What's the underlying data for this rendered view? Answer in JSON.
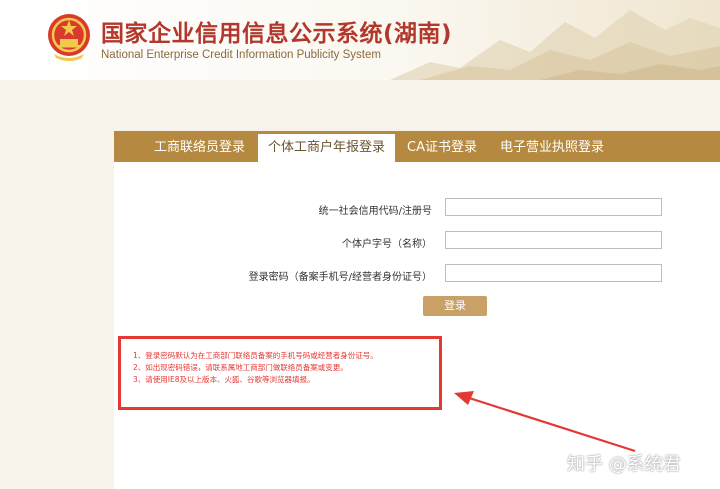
{
  "header": {
    "title": "国家企业信用信息公示系统(湖南)",
    "subtitle": "National Enterprise Credit Information Publicity System"
  },
  "tabs": [
    {
      "label": "工商联络员登录",
      "active": false
    },
    {
      "label": "个体工商户年报登录",
      "active": true
    },
    {
      "label": "CA证书登录",
      "active": false
    },
    {
      "label": "电子营业执照登录",
      "active": false
    }
  ],
  "form": {
    "credit_code_label": "统一社会信用代码/注册号",
    "name_label": "个体户字号（名称）",
    "password_label": "登录密码（备案手机号/经营者身份证号）",
    "credit_code_value": "",
    "name_value": "",
    "password_value": "",
    "login_button": "登录"
  },
  "notice": {
    "items": [
      "1、登录密码默认为在工商部门联络员备案的手机号码或经营者身份证号。",
      "2、如出现密码错误，请联系属地工商部门做联络员备案或变更。",
      "3、请使用IE8及以上版本、火狐、谷歌等浏览器填报。"
    ]
  },
  "watermark": "知乎 @系统君",
  "colors": {
    "tab_bar": "#b5893f",
    "title_red": "#b2382b",
    "annotation_red": "#e43835",
    "button": "#c9a066"
  }
}
